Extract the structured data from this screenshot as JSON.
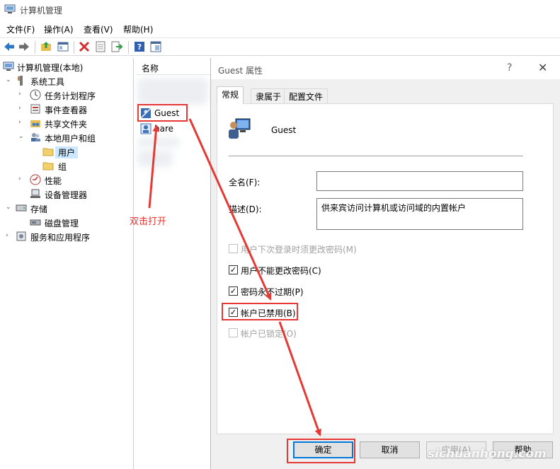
{
  "window": {
    "title": "计算机管理"
  },
  "menu": [
    "文件(F)",
    "操作(A)",
    "查看(V)",
    "帮助(H)"
  ],
  "toolbar_icons": [
    "back-arrow-icon",
    "forward-arrow-icon",
    "up-folder-icon",
    "show-hide-tree-icon",
    "delete-icon",
    "properties-icon",
    "export-icon",
    "help-icon",
    "console-icon"
  ],
  "tree": {
    "root": "计算机管理(本地)",
    "system_tools": "系统工具",
    "task_scheduler": "任务计划程序",
    "event_viewer": "事件查看器",
    "shared_folders": "共享文件夹",
    "local_users_groups": "本地用户和组",
    "users": "用户",
    "groups": "组",
    "performance": "性能",
    "device_manager": "设备管理器",
    "storage": "存储",
    "disk_management": "磁盘管理",
    "services_apps": "服务和应用程序"
  },
  "list": {
    "header": "名称",
    "items": [
      "Guest",
      "hare"
    ]
  },
  "dialog": {
    "title": "Guest 属性",
    "help": "?",
    "close": "✕",
    "tabs": [
      "常规",
      "隶属于",
      "配置文件"
    ],
    "username": "Guest",
    "fullname_label": "全名(F):",
    "fullname_value": "",
    "description_label": "描述(D):",
    "description_value": "供来宾访问计算机或访问域的内置帐户",
    "checkboxes": [
      {
        "label": "用户下次登录时须更改密码(M)",
        "checked": false,
        "disabled": true
      },
      {
        "label": "用户不能更改密码(C)",
        "checked": true,
        "disabled": false
      },
      {
        "label": "密码永不过期(P)",
        "checked": true,
        "disabled": false
      },
      {
        "label": "帐户已禁用(B)",
        "checked": true,
        "disabled": false
      },
      {
        "label": "帐户已锁定(O)",
        "checked": false,
        "disabled": true
      }
    ],
    "buttons": {
      "ok": "确定",
      "cancel": "取消",
      "apply": "应用(A)",
      "help": "帮助"
    }
  },
  "annotation": {
    "text": "双击打开",
    "color": "#e53935"
  },
  "watermark": "sichuanhong.com"
}
